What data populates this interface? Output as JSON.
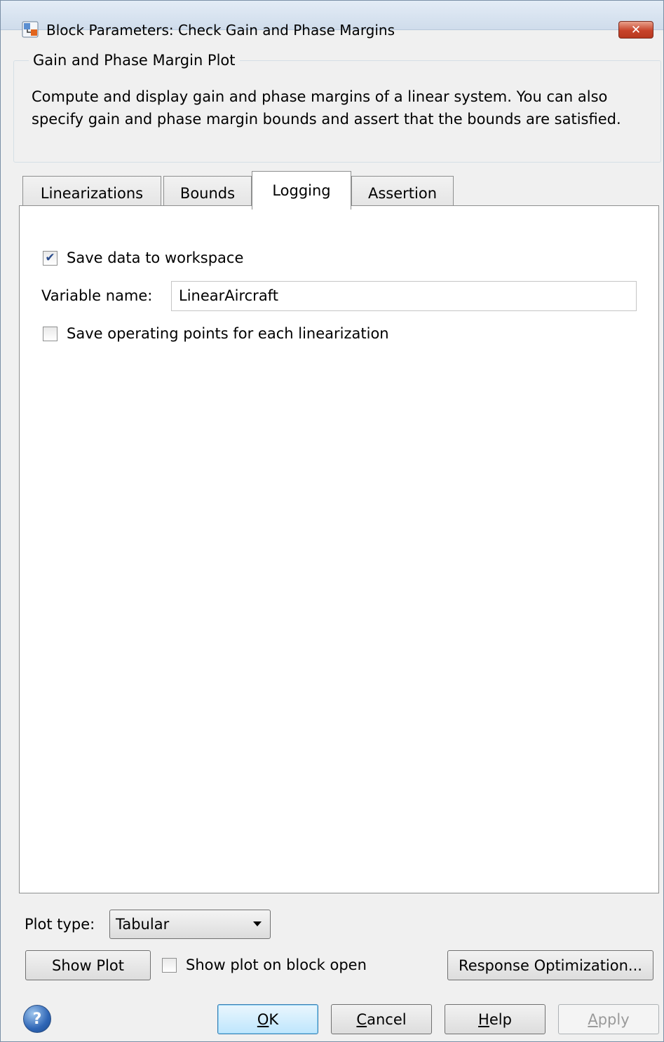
{
  "window": {
    "title": "Block Parameters: Check Gain and Phase Margins",
    "close_icon": "close-icon"
  },
  "description": {
    "group_title": "Gain and Phase Margin Plot",
    "text": "Compute and display gain and phase margins of a linear system. You can also specify gain and phase margin bounds and assert that the bounds are satisfied."
  },
  "tabs": [
    {
      "label": "Linearizations",
      "active": false
    },
    {
      "label": "Bounds",
      "active": false
    },
    {
      "label": "Logging",
      "active": true
    },
    {
      "label": "Assertion",
      "active": false
    }
  ],
  "logging": {
    "save_data_label": "Save data to workspace",
    "save_data_checked": true,
    "variable_name_label": "Variable name:",
    "variable_name_value": "LinearAircraft",
    "save_op_points_label": "Save operating points for each linearization",
    "save_op_points_checked": false
  },
  "plot": {
    "plot_type_label": "Plot type:",
    "plot_type_value": "Tabular",
    "show_plot_label": "Show Plot",
    "show_on_open_label": "Show plot on block open",
    "show_on_open_checked": false,
    "response_optimization_label": "Response Optimization..."
  },
  "buttons": {
    "ok": {
      "pre": "",
      "mnemonic": "O",
      "post": "K"
    },
    "cancel": {
      "pre": "",
      "mnemonic": "C",
      "post": "ancel"
    },
    "help": {
      "pre": "",
      "mnemonic": "H",
      "post": "elp"
    },
    "apply": {
      "pre": "",
      "mnemonic": "A",
      "post": "pply"
    }
  },
  "icons": {
    "title": "simulink-block-icon",
    "help": "help-icon"
  }
}
